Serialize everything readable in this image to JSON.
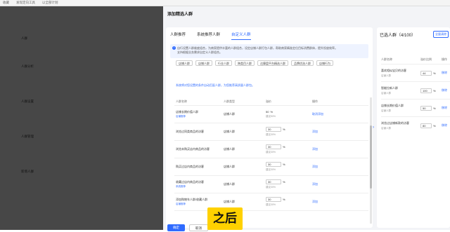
{
  "topbar": {
    "items": [
      "收藏",
      "发现定向工具",
      "以全部计划"
    ]
  },
  "background": {
    "rows": [
      "人群",
      "人群分析",
      "人群设置",
      "人群管理",
      "新增人群"
    ]
  },
  "panel": {
    "title": "添加精选人群",
    "tabs": [
      "人群推荐",
      "系统推荐人群",
      "自定义人群"
    ],
    "notice_line1": "自行设置人群维度组合，为商家提供丰富的人群组合，设定店铺人群打包人群，帮助商家精准定位目标消费群体，提升投放效率。",
    "notice_line2": "支持根据业务需求自定义人群组合。",
    "filters": [
      "店铺人群",
      "店铺人群",
      "行业人群",
      "跨类目人群",
      "达摩盘平台精选人群",
      "品牌优选人群",
      "店铺行为"
    ],
    "tip": "系统将对您设置的条件自动匹配人群，为您推荐高质量人群包。",
    "table_headers": [
      "人群名称",
      "人群类型",
      "溢价",
      "操作"
    ],
    "rows": [
      {
        "name": "店铺长期价值人群",
        "sub": "店铺推荐",
        "type": "店铺人群",
        "value": "50",
        "hint": "建议50%",
        "action": "取消添加"
      },
      {
        "name": "浏览过同类商品的访客",
        "sub": "",
        "type": "店铺人群",
        "value": "30",
        "hint": "建议30%",
        "action": "添加"
      },
      {
        "name": "浏览未购买店内商品的访客",
        "sub": "",
        "type": "店铺人群",
        "value": "30",
        "hint": "建议30%",
        "action": "添加"
      },
      {
        "name": "购买过店内商品的访客",
        "sub": "",
        "type": "店铺人群",
        "value": "30",
        "hint": "建议30%",
        "action": "添加"
      },
      {
        "name": "收藏过店内商品的访客",
        "sub": "系统推荐",
        "type": "店铺人群",
        "value": "30",
        "hint": "建议30%",
        "action": "添加"
      },
      {
        "name": "添加购物车人群/收藏人群",
        "sub": "店铺推荐",
        "type": "店铺人群",
        "value": "30",
        "hint": "建议30%",
        "action": "添加"
      }
    ],
    "selected_title": "已选人群（4/100）",
    "clear_label": "全量清除",
    "selected_headers": [
      "人群名称",
      "溢价比例",
      "操作"
    ],
    "selected_rows": [
      {
        "name": "喜欢相似宝贝的访客",
        "sub": "店铺人群",
        "value": "44",
        "action": "移除"
      },
      {
        "name": "智能拉新人群",
        "sub": "店铺人群",
        "value": "100",
        "action": "移除"
      },
      {
        "name": "店铺长期价值人群",
        "sub": "店铺人群",
        "value": "50",
        "action": "移除"
      },
      {
        "name": "浏览过店铺新款的访客",
        "sub": "店铺人群",
        "value": "80",
        "action": "移除"
      }
    ],
    "confirm_label": "确定",
    "cancel_label": "取消"
  },
  "caption": "之后"
}
